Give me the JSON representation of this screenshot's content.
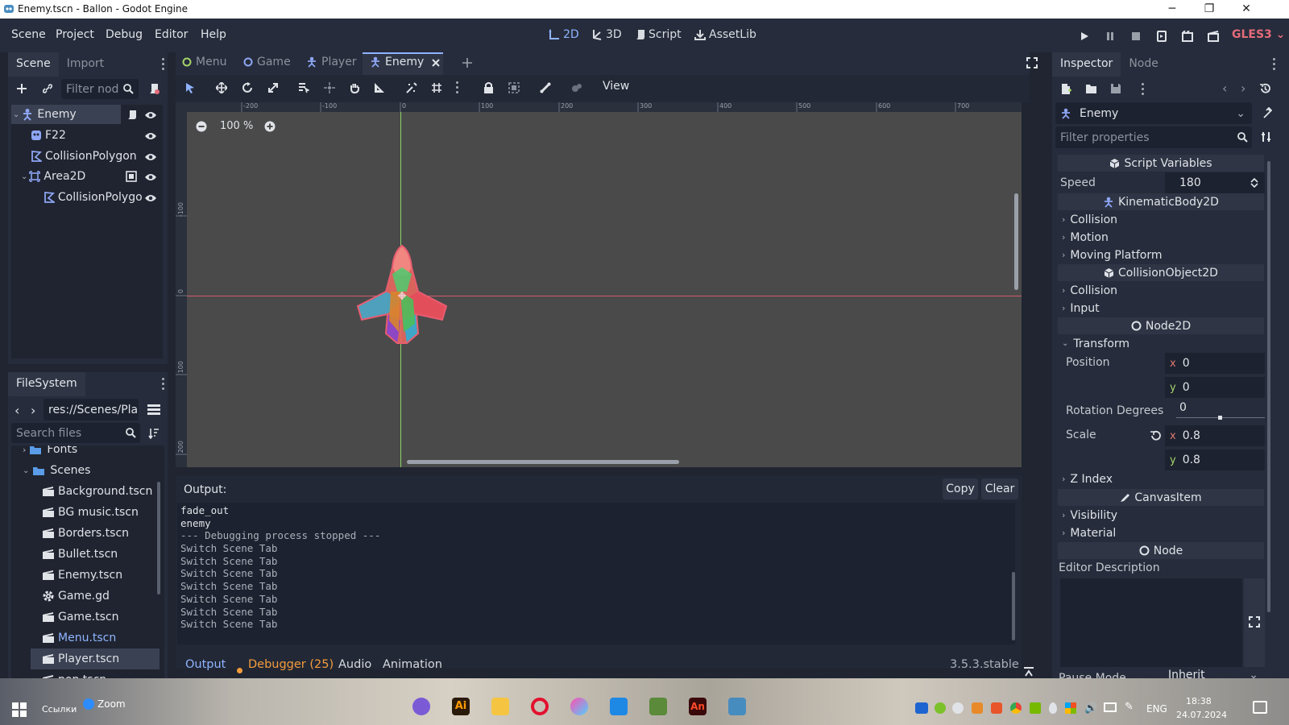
{
  "window": {
    "title": "Enemy.tscn - Ballon - Godot Engine",
    "minimize": "─",
    "restore": "❐",
    "close": "✕"
  },
  "menubar": {
    "menus": [
      "Scene",
      "Project",
      "Debug",
      "Editor",
      "Help"
    ],
    "workspaces": [
      "2D",
      "3D",
      "Script",
      "AssetLib"
    ],
    "renderer": "GLES3"
  },
  "scene_dock": {
    "tabs": [
      "Scene",
      "Import"
    ],
    "filter_placeholder": "Filter nod",
    "nodes": [
      "Enemy",
      "F22",
      "CollisionPolygon",
      "Area2D",
      "CollisionPolygo"
    ]
  },
  "filesystem": {
    "tab": "FileSystem",
    "path": "res://Scenes/Pla",
    "search_placeholder": "Search files",
    "items": [
      {
        "name": "Fonts",
        "type": "folder"
      },
      {
        "name": "Scenes",
        "type": "folder"
      },
      {
        "name": "Background.tscn",
        "type": "scene"
      },
      {
        "name": "BG music.tscn",
        "type": "scene"
      },
      {
        "name": "Borders.tscn",
        "type": "scene"
      },
      {
        "name": "Bullet.tscn",
        "type": "scene"
      },
      {
        "name": "Enemy.tscn",
        "type": "scene"
      },
      {
        "name": "Game.gd",
        "type": "script"
      },
      {
        "name": "Game.tscn",
        "type": "scene"
      },
      {
        "name": "Menu.tscn",
        "type": "scene"
      },
      {
        "name": "Player.tscn",
        "type": "scene"
      },
      {
        "name": "pop.tscn",
        "type": "scene"
      }
    ]
  },
  "scene_tabs": [
    "Menu",
    "Game",
    "Player",
    "Enemy"
  ],
  "toolbar": {
    "view": "View"
  },
  "viewport": {
    "zoom": "100 %",
    "ruler_h": [
      "-200",
      "-100",
      "0",
      "100",
      "200",
      "300",
      "400",
      "500",
      "600",
      "700"
    ],
    "ruler_v": [
      "-100",
      "0",
      "100",
      "200"
    ]
  },
  "output": {
    "label": "Output:",
    "copy": "Copy",
    "clear": "Clear",
    "lines": [
      "fade_out",
      "enemy",
      "--- Debugging process stopped ---",
      "Switch Scene Tab",
      "Switch Scene Tab",
      "Switch Scene Tab",
      "Switch Scene Tab",
      "Switch Scene Tab",
      "Switch Scene Tab",
      "Switch Scene Tab"
    ]
  },
  "bottom_tabs": {
    "output": "Output",
    "debugger": "Debugger (25)",
    "audio": "Audio",
    "animation": "Animation",
    "version": "3.5.3.stable"
  },
  "inspector": {
    "tabs": [
      "Inspector",
      "Node"
    ],
    "object": "Enemy",
    "filter_placeholder": "Filter properties",
    "script_variables": "Script Variables",
    "speed_label": "Speed",
    "speed_value": "180",
    "kinematic": "KinematicBody2D",
    "kinematic_groups": [
      "Collision",
      "Motion",
      "Moving Platform"
    ],
    "collision_object": "CollisionObject2D",
    "collision_groups": [
      "Collision",
      "Input"
    ],
    "node2d": "Node2D",
    "transform": "Transform",
    "position_label": "Position",
    "position_x": "0",
    "position_y": "0",
    "rotation_label": "Rotation Degrees",
    "rotation_value": "0",
    "scale_label": "Scale",
    "scale_x": "0.8",
    "scale_y": "0.8",
    "z_index": "Z Index",
    "canvas_item": "CanvasItem",
    "canvas_groups": [
      "Visibility",
      "Material"
    ],
    "node": "Node",
    "editor_description": "Editor Description",
    "pause_mode_label": "Pause Mode",
    "pause_mode_value": "Inherit",
    "axis_x": "x",
    "axis_y": "y"
  },
  "taskbar": {
    "links": "Ссылки",
    "zoom": "Zoom",
    "lang": "ENG",
    "time": "18:38",
    "date": "24.07.2024",
    "adobe_ai": "Ai",
    "adobe_an": "An"
  }
}
